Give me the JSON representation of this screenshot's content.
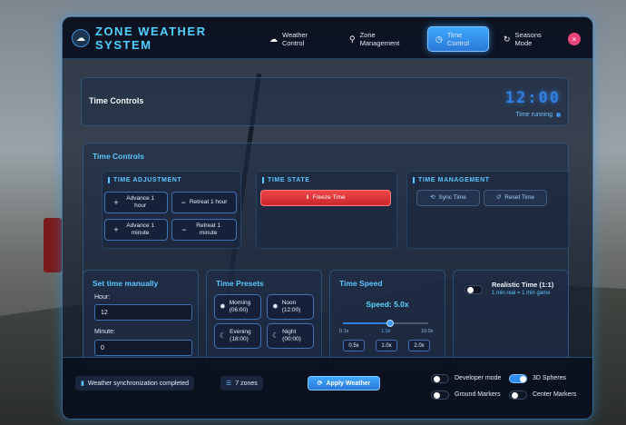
{
  "app": {
    "title": "Zone Weather System",
    "logo_icon": "cloud-sun-icon"
  },
  "nav": {
    "tabs": [
      {
        "label": "Weather Control",
        "icon": "cloud-icon",
        "active": false
      },
      {
        "label": "Zone Management",
        "icon": "location-pin-icon",
        "active": false
      },
      {
        "label": "Time Control",
        "icon": "clock-icon",
        "active": true
      },
      {
        "label": "Seasons Mode",
        "icon": "refresh-icon",
        "active": false
      }
    ],
    "close_label": "×"
  },
  "time_header": {
    "title": "Time Controls",
    "clock": "12:00",
    "status": "Time running"
  },
  "time_controls": {
    "title": "Time Controls",
    "adjustment": {
      "heading": "TIME ADJUSTMENT",
      "advance_hour": "Advance 1 hour",
      "retreat_hour": "Retreat 1 hour",
      "advance_minute": "Advance 1 minute",
      "retreat_minute": "Retreat 1 minute"
    },
    "state": {
      "heading": "TIME STATE",
      "freeze": "Freeze Time"
    },
    "management": {
      "heading": "TIME MANAGEMENT",
      "sync": "Sync Time",
      "reset": "Reset Time"
    }
  },
  "manual": {
    "title": "Set time manually",
    "hour_label": "Hour:",
    "hour_value": "12",
    "minute_label": "Minute:",
    "minute_value": "0"
  },
  "presets": {
    "title": "Time Presets",
    "items": [
      {
        "label": "Morning (06:00)",
        "icon": "sun-icon"
      },
      {
        "label": "Noon (12:00)",
        "icon": "sun-icon"
      },
      {
        "label": "Evening (18:00)",
        "icon": "moon-icon"
      },
      {
        "label": "Night (00:00)",
        "icon": "moon-icon"
      }
    ]
  },
  "speed": {
    "title": "Time Speed",
    "value_label": "Speed: 5.0x",
    "slider_fraction": 0.55,
    "scale": [
      "0.1x",
      "1.0x",
      "10.0x"
    ],
    "buttons": [
      "0.5x",
      "1.0x",
      "2.0x"
    ]
  },
  "realistic": {
    "title": "Realistic Time (1:1)",
    "subtitle": "1 min real = 1 min game",
    "enabled": false
  },
  "footer": {
    "status": "Weather synchronization completed",
    "zones": "7 zones",
    "apply": "Apply Weather",
    "options": [
      {
        "label": "Developer mode",
        "enabled": false
      },
      {
        "label": "3D Spheres",
        "enabled": true
      },
      {
        "label": "Ground Markers",
        "enabled": false
      },
      {
        "label": "Center Markers",
        "enabled": false
      }
    ]
  },
  "colors": {
    "accent": "#4fd1ff",
    "primary": "#2a78d8",
    "danger": "#e63a3a",
    "close": "#e8457a"
  }
}
